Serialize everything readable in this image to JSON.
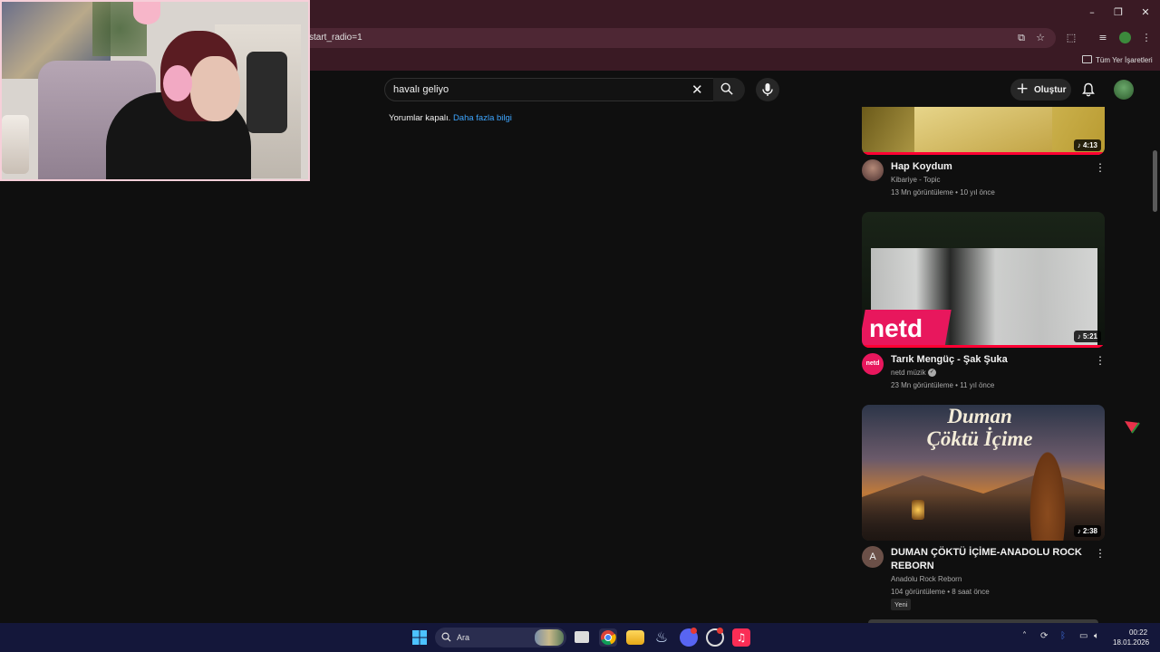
{
  "browser": {
    "url_fragment": "start_radio=1",
    "bookmarks_label": "Tüm Yer İşaretleri"
  },
  "youtube": {
    "search_query": "havalı geliyo",
    "create_label": "Oluştur",
    "comments_off": "Yorumlar kapalı.",
    "learn_more": "Daha fazla bilgi"
  },
  "videos": [
    {
      "title": "Hap Koydum",
      "channel": "Kibariye - Topic",
      "views": "13 Mn görüntüleme",
      "age": "10 yıl önce",
      "duration": "4:13"
    },
    {
      "title": "Tarık Mengüç - Şak Şuka",
      "channel": "netd müzik",
      "verified": true,
      "views": "23 Mn görüntüleme",
      "age": "11 yıl önce",
      "duration": "5:21",
      "thumb_logo": "netd"
    },
    {
      "title": "DUMAN ÇÖKTÜ İÇİME-ANADOLU ROCK REBORN",
      "channel": "Anadolu Rock Reborn",
      "views": "104 görüntüleme",
      "age": "8 saat önce",
      "duration": "2:38",
      "badge": "Yeni",
      "avatar_letter": "A",
      "thumb_title_line1": "Duman",
      "thumb_title_line2": "Çöktü İçime"
    }
  ],
  "taskbar": {
    "search_label": "Ara",
    "time": "00:22",
    "date": "18.01.2026"
  },
  "colors": {
    "accent_link": "#3ea6ff",
    "browser_frame": "#3a1a24",
    "taskbar": "#14173a",
    "yt_red": "#ff0033"
  }
}
